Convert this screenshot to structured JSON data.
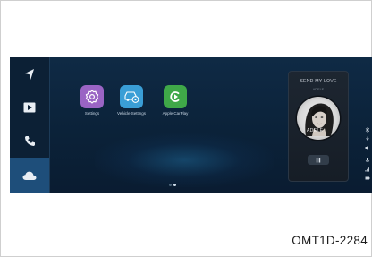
{
  "screen": {
    "sidebar": {
      "items": [
        {
          "id": "navigation",
          "icon": "navigation-arrow-icon",
          "active": false
        },
        {
          "id": "media",
          "icon": "play-icon",
          "active": false
        },
        {
          "id": "phone",
          "icon": "phone-icon",
          "active": false
        },
        {
          "id": "connected",
          "icon": "cloud-icon",
          "active": true
        }
      ]
    },
    "apps": [
      {
        "label": "Settings",
        "icon": "gear-icon",
        "color": "#9a64c4"
      },
      {
        "label": "Vehicle Settings",
        "icon": "vehicle-gear-icon",
        "color": "#3a9ed6"
      },
      {
        "label": "Apple CarPlay",
        "icon": "carplay-icon",
        "color": "#3fa848"
      }
    ],
    "page_indicator": {
      "count": 2,
      "active_index": 1
    },
    "now_playing": {
      "title": "SEND MY LOVE",
      "artist": "ADELE",
      "album_text": "ADELE",
      "control": "pause-icon"
    },
    "status_icons": [
      "bluetooth-icon",
      "usb-icon",
      "volume-icon",
      "microphone-icon",
      "signal-icon",
      "battery-icon"
    ]
  },
  "caption": {
    "code": "OMT1D-2284"
  },
  "colors": {
    "screen_bg": "#0b2239",
    "sidebar_active": "#1e4e7a",
    "accent": "#3a9ed6"
  }
}
